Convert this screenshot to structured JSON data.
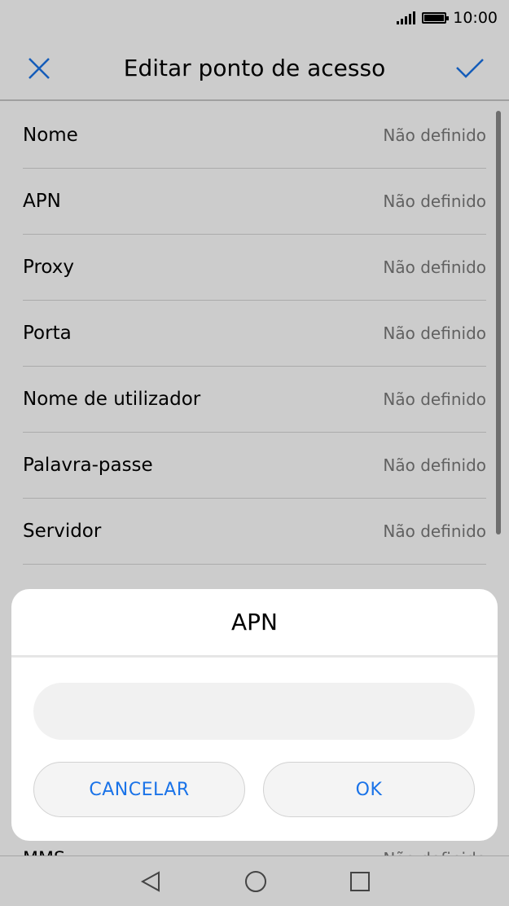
{
  "status_bar": {
    "time": "10:00",
    "icons": [
      "signal-icon",
      "battery-icon"
    ]
  },
  "app_bar": {
    "title": "Editar ponto de acesso",
    "close_icon": "close-icon",
    "confirm_icon": "check-icon"
  },
  "settings": [
    {
      "label": "Nome",
      "value": "Não definido"
    },
    {
      "label": "APN",
      "value": "Não definido"
    },
    {
      "label": "Proxy",
      "value": "Não definido"
    },
    {
      "label": "Porta",
      "value": "Não definido"
    },
    {
      "label": "Nome de utilizador",
      "value": "Não definido"
    },
    {
      "label": "Palavra-passe",
      "value": "Não definido"
    },
    {
      "label": "Servidor",
      "value": "Não definido"
    }
  ],
  "partial_row": {
    "label": "MMS",
    "value": "Não definido"
  },
  "dialog": {
    "title": "APN",
    "input_value": "",
    "cancel_label": "CANCELAR",
    "ok_label": "OK"
  },
  "nav_bar": {
    "icons": [
      "back-icon",
      "home-icon",
      "recents-icon"
    ]
  },
  "colors": {
    "accent": "#1a73e8",
    "secondary_text": "#7a7a7a"
  }
}
